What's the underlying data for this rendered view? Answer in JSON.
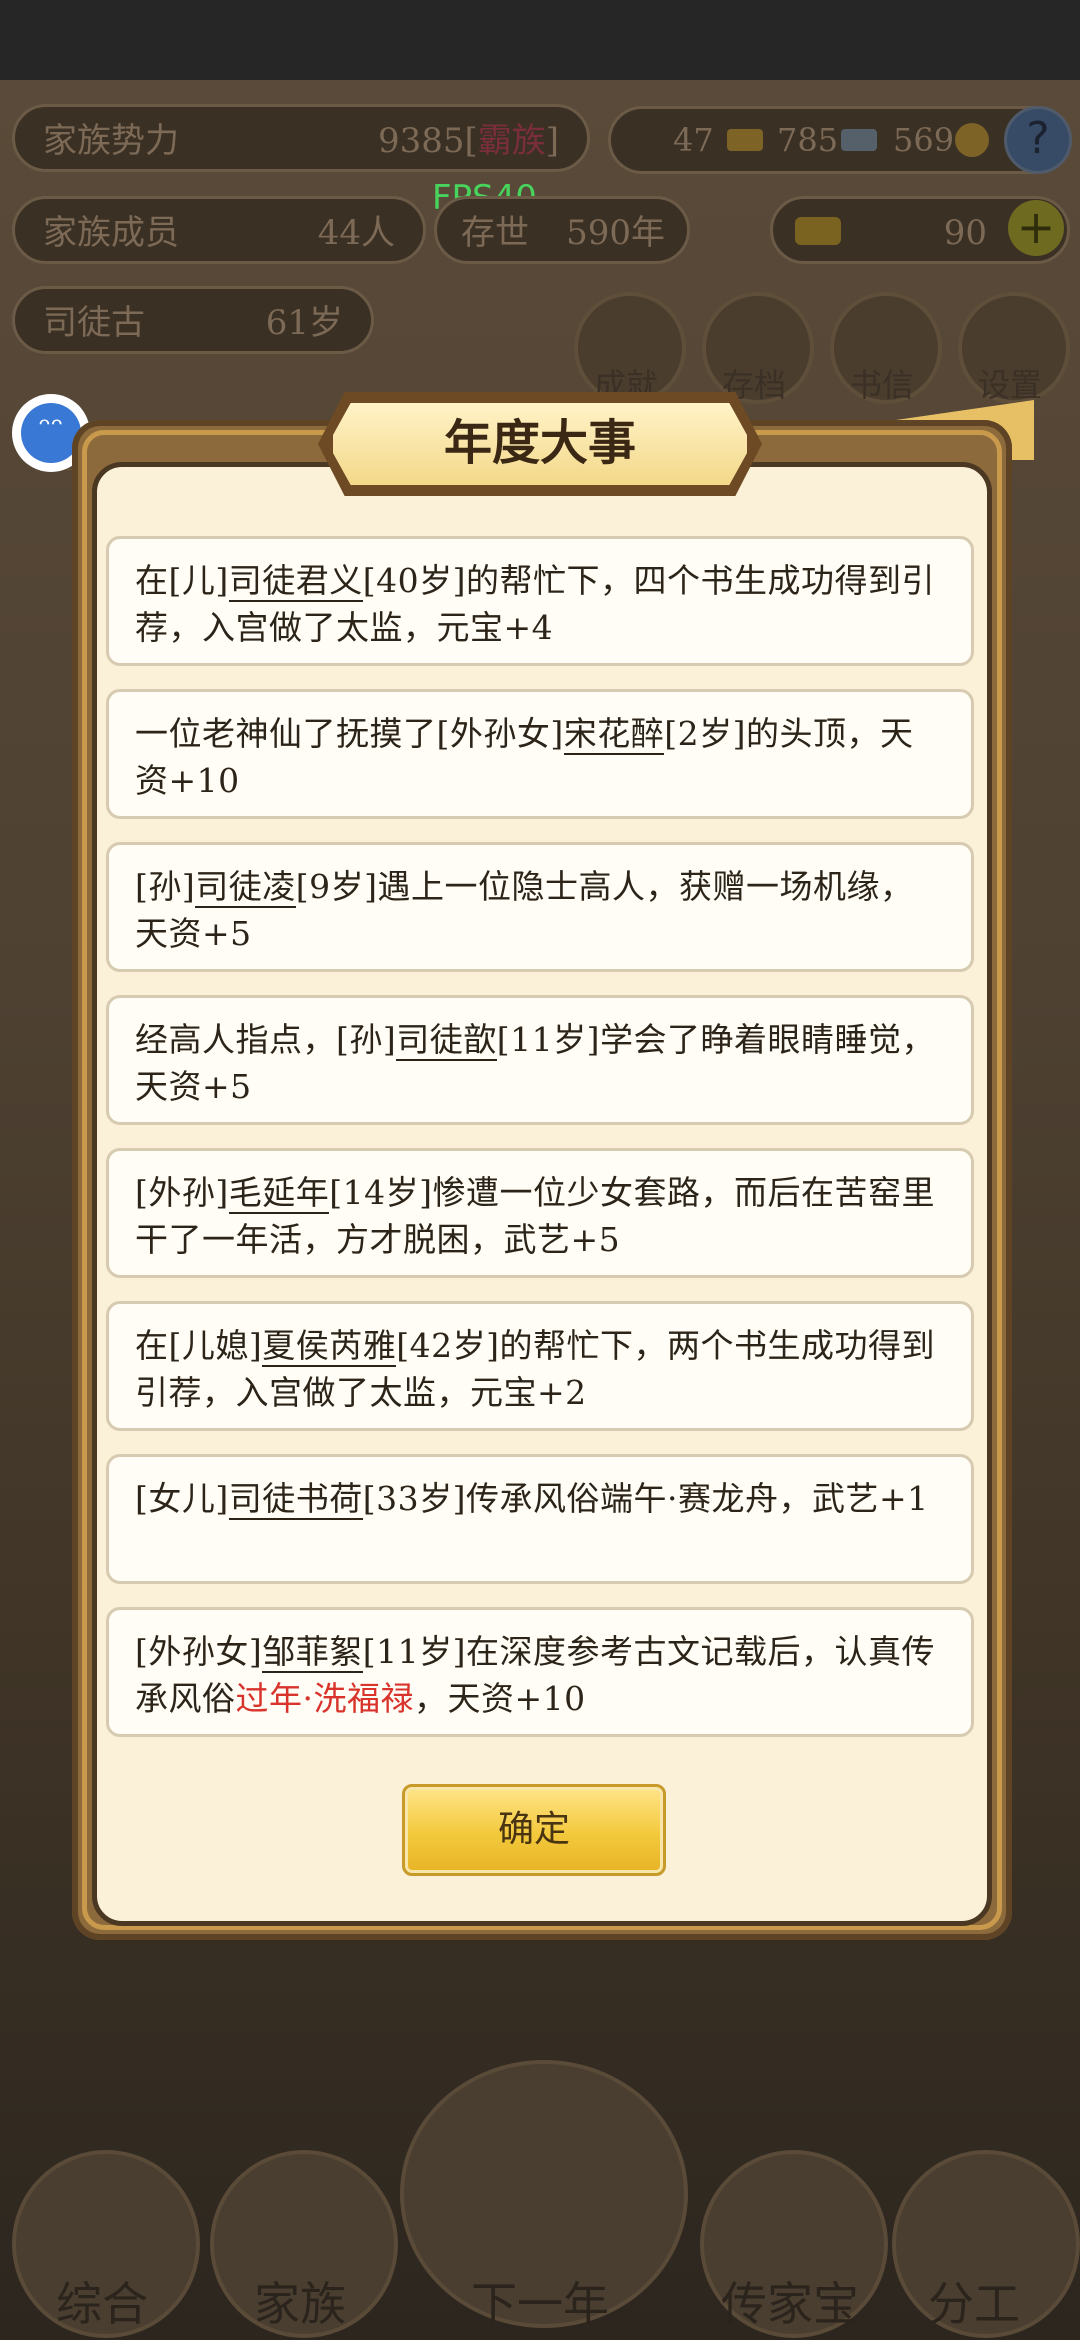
{
  "hud": {
    "clan_power_label": "家族势力",
    "clan_power_value": "9385[",
    "clan_power_rank": "霸族",
    "clan_power_close": "]",
    "resource_1": "47",
    "resource_2": "785",
    "resource_3": "569",
    "members_label": "家族成员",
    "members_value": "44人",
    "exist_label": "存世",
    "exist_value": "590年",
    "ingots": "90",
    "patriarch_name": "司徒古",
    "patriarch_age": "61岁",
    "fps": "FPS40",
    "help": "?",
    "plus": "+",
    "menu_buttons": [
      "成就",
      "存档",
      "书信",
      "设置"
    ]
  },
  "bottom_nav": [
    "综合",
    "家族",
    "下一年",
    "传家宝",
    "分工"
  ],
  "modal": {
    "title": "年度大事",
    "events": [
      {
        "pre": "在[儿]",
        "name": "司徒君义",
        "post": "[40岁]的帮忙下，四个书生成功得到引荐，入宫做了太监，元宝+4"
      },
      {
        "pre": "一位老神仙了抚摸了[外孙女]",
        "name": "宋花醉",
        "post": "[2岁]的头顶，天资+10"
      },
      {
        "pre": "[孙]",
        "name": "司徒凌",
        "post": "[9岁]遇上一位隐士高人，获赠一场机缘，天资+5"
      },
      {
        "pre": "经高人指点，[孙]",
        "name": "司徒歆",
        "post": "[11岁]学会了睁着眼睛睡觉，天资+5"
      },
      {
        "pre": "[外孙]",
        "name": "毛延年",
        "post": "[14岁]惨遭一位少女套路，而后在苦窑里干了一年活，方才脱困，武艺+5"
      },
      {
        "pre": "在[儿媳]",
        "name": "夏侯芮雅",
        "post": "[42岁]的帮忙下，两个书生成功得到引荐，入宫做了太监，元宝+2"
      },
      {
        "pre": "[女儿]",
        "name": "司徒书荷",
        "post": "[33岁]传承风俗端午·赛龙舟，武艺+1"
      },
      {
        "pre": "[外孙女]",
        "name": "邹菲絮",
        "post": "[11岁]在深度参考古文记载后，认真传承风俗",
        "highlight": "过年·洗福禄",
        "tail": "，天资+10"
      }
    ],
    "confirm_label": "确定"
  },
  "colors": {
    "highlight_red": "#d8342c",
    "confirm_gold": "#f3c93c",
    "panel_cream": "#fbf1d9"
  }
}
